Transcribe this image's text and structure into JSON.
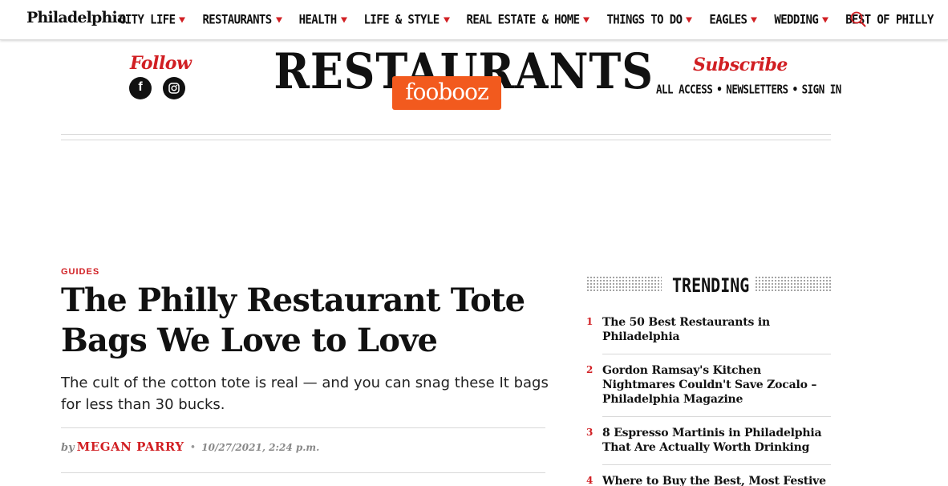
{
  "nav": {
    "logo": "Philadelphia",
    "items": [
      {
        "label": "CITY LIFE",
        "dropdown": true
      },
      {
        "label": "RESTAURANTS",
        "dropdown": true
      },
      {
        "label": "HEALTH",
        "dropdown": true
      },
      {
        "label": "LIFE & STYLE",
        "dropdown": true
      },
      {
        "label": "REAL ESTATE & HOME",
        "dropdown": true
      },
      {
        "label": "THINGS TO DO",
        "dropdown": true
      },
      {
        "label": "EAGLES",
        "dropdown": true
      },
      {
        "label": "WEDDING",
        "dropdown": true
      },
      {
        "label": "BEST OF PHILLY",
        "dropdown": false
      }
    ],
    "search_icon": "search-icon"
  },
  "masthead": {
    "follow_label": "Follow",
    "facebook_glyph": "f",
    "section_title": "RESTAURANTS",
    "badge": "foobooz",
    "subscribe_label": "Subscribe",
    "links": [
      "ALL ACCESS",
      "NEWSLETTERS",
      "SIGN IN"
    ],
    "link_separator": "•"
  },
  "article": {
    "category": "GUIDES",
    "headline": "The Philly Restaurant Tote Bags We Love to Love",
    "dek": "The cult of the cotton tote is real — and you can snag these It bags for less than 30 bucks.",
    "byline_prefix": "by",
    "author": "MEGAN PARRY",
    "byline_separator": "•",
    "date": "10/27/2021, 2:24 p.m."
  },
  "trending": {
    "title": "TRENDING",
    "items": [
      {
        "number": "1",
        "title": "The 50 Best Restaurants in Philadelphia"
      },
      {
        "number": "2",
        "title": "Gordon Ramsay's Kitchen Nightmares Couldn't Save Zocalo – Philadelphia Magazine"
      },
      {
        "number": "3",
        "title": "8 Espresso Martinis in Philadelphia That Are Actually Worth Drinking"
      },
      {
        "number": "4",
        "title": "Where to Buy the Best, Most Festive"
      }
    ]
  },
  "colors": {
    "accent_red": "#d11f23",
    "foobooz_orange": "#f25a1e",
    "text": "#111111",
    "rule": "#d8d8d8"
  }
}
